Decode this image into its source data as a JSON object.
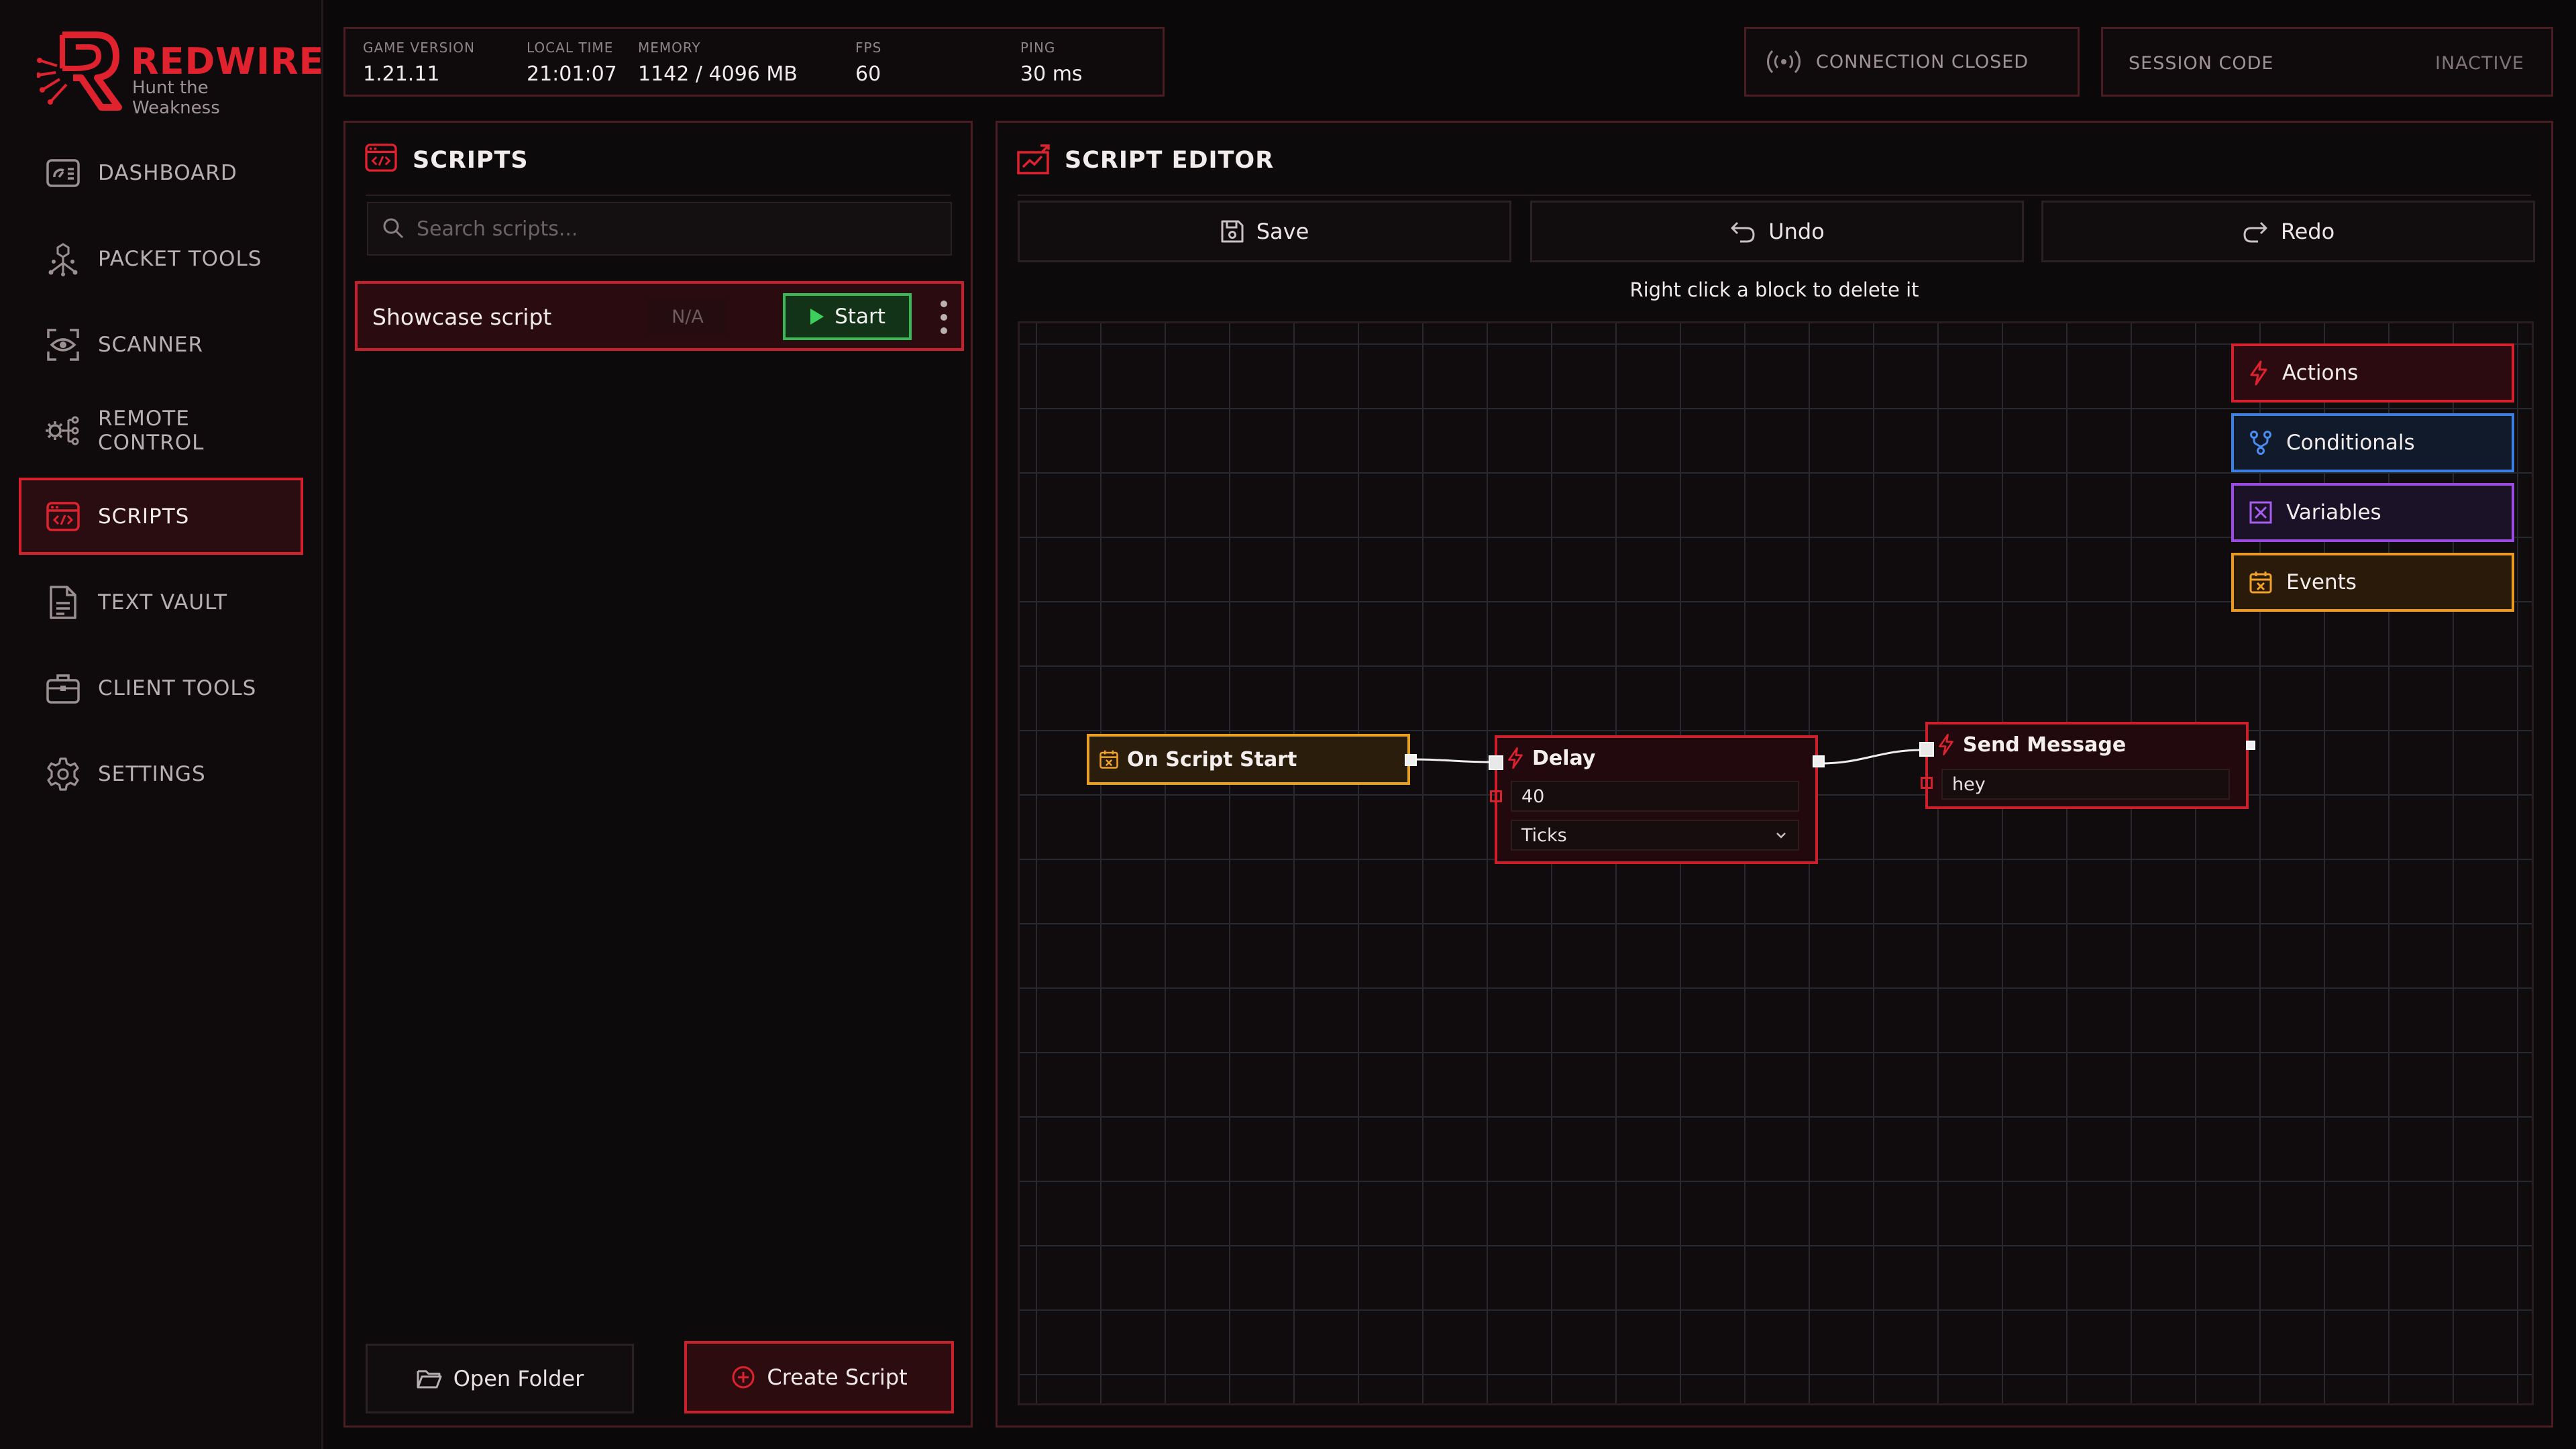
{
  "app": {
    "name": "REDWIRE",
    "tagline": "Hunt the Weakness",
    "brand_color": "#e0212e"
  },
  "nav": [
    {
      "label": "DASHBOARD",
      "icon": "dashboard-icon",
      "active": false
    },
    {
      "label": "PACKET TOOLS",
      "icon": "packet-tools-icon",
      "active": false
    },
    {
      "label": "SCANNER",
      "icon": "eye-scan-icon",
      "active": false
    },
    {
      "label": "REMOTE CONTROL",
      "icon": "remote-control-icon",
      "active": false
    },
    {
      "label": "SCRIPTS",
      "icon": "scripts-icon",
      "active": true
    },
    {
      "label": "TEXT VAULT",
      "icon": "document-icon",
      "active": false
    },
    {
      "label": "CLIENT TOOLS",
      "icon": "briefcase-icon",
      "active": false
    },
    {
      "label": "SETTINGS",
      "icon": "gear-icon",
      "active": false
    }
  ],
  "stats": {
    "game_version": {
      "label": "GAME VERSION",
      "value": "1.21.11"
    },
    "local_time": {
      "label": "LOCAL TIME",
      "value": "21:01:07"
    },
    "memory": {
      "label": "MEMORY",
      "value": "1142 / 4096 MB"
    },
    "fps": {
      "label": "FPS",
      "value": "60"
    },
    "ping": {
      "label": "PING",
      "value": "30 ms"
    }
  },
  "connection": {
    "label": "CONNECTION CLOSED",
    "icon": "broadcast-icon"
  },
  "session": {
    "label": "SESSION CODE",
    "value": "INACTIVE"
  },
  "scripts_panel": {
    "title": "SCRIPTS",
    "search_placeholder": "Search scripts...",
    "scripts": [
      {
        "name": "Showcase script",
        "status": "N/A",
        "start_label": "Start"
      }
    ],
    "open_folder_label": "Open Folder",
    "create_script_label": "Create Script"
  },
  "editor": {
    "title": "SCRIPT EDITOR",
    "save_label": "Save",
    "undo_label": "Undo",
    "redo_label": "Redo",
    "hint": "Right click a block to delete it",
    "palette": {
      "actions": "Actions",
      "conditionals": "Conditionals",
      "variables": "Variables",
      "events": "Events"
    },
    "nodes": {
      "start": {
        "title": "On Script Start"
      },
      "delay": {
        "title": "Delay",
        "amount": "40",
        "unit": "Ticks"
      },
      "send": {
        "title": "Send Message",
        "message": "hey"
      }
    },
    "colors": {
      "actions": "#d3212e",
      "conditionals": "#3d7fe0",
      "variables": "#9a4be0",
      "events": "#e99a23"
    }
  }
}
